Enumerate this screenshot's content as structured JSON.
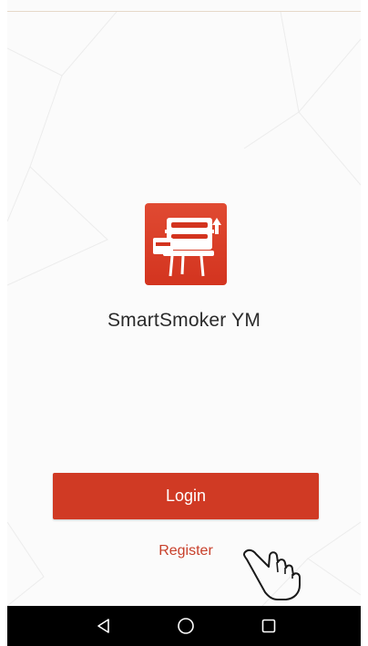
{
  "app": {
    "name": "SmartSmoker YM",
    "logo_icon": "smoker-grill-icon"
  },
  "actions": {
    "login_label": "Login",
    "register_label": "Register",
    "gesture_icon": "tap-hand-icon"
  },
  "navbar": {
    "back_icon": "back-triangle-icon",
    "home_icon": "home-circle-icon",
    "recents_icon": "recents-square-icon"
  },
  "colors": {
    "accent": "#d03a24",
    "link": "#c8402b",
    "text": "#2b2b2b",
    "navbar_bg": "#000000"
  }
}
